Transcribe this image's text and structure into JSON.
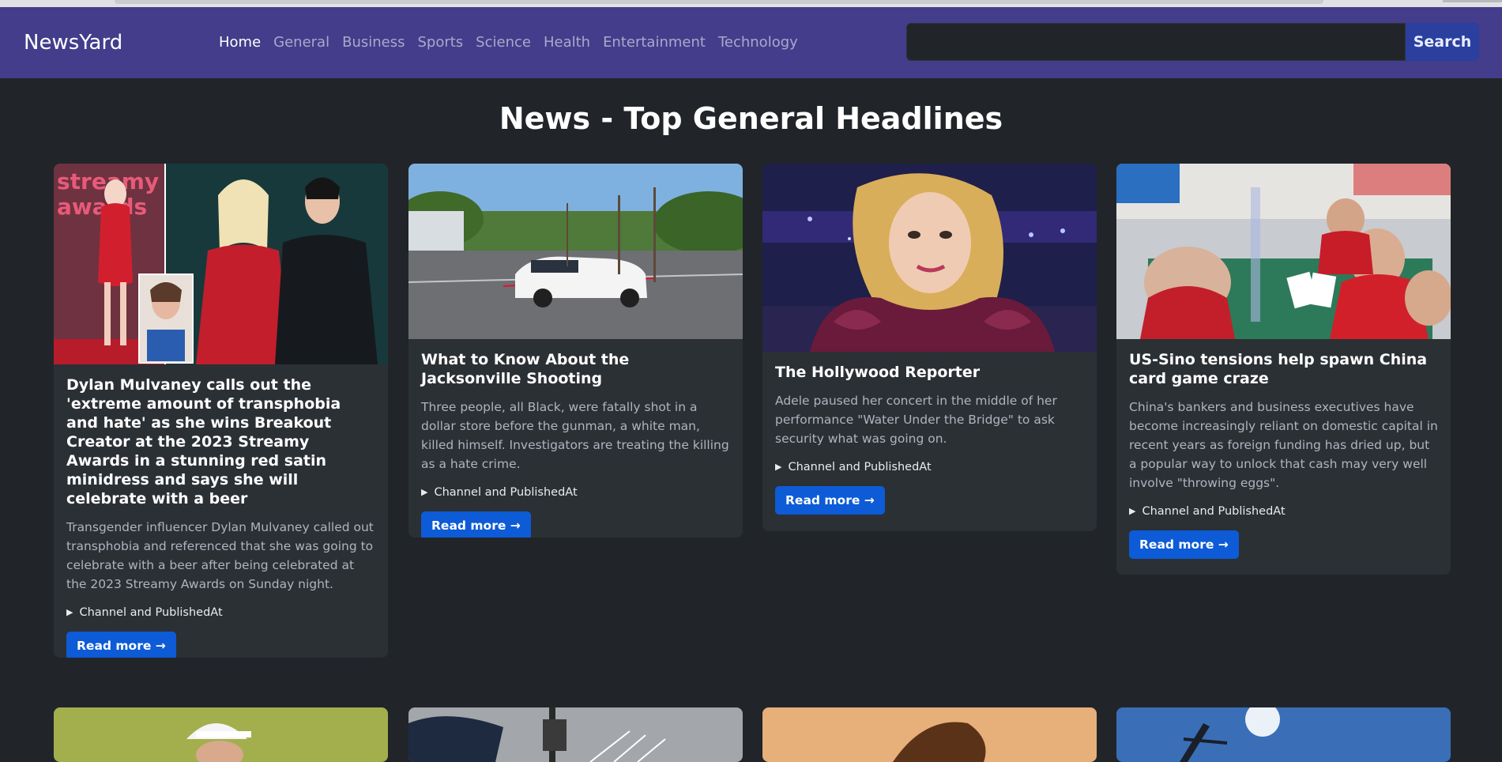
{
  "nav": {
    "brand": "NewsYard",
    "links": [
      "Home",
      "General",
      "Business",
      "Sports",
      "Science",
      "Health",
      "Entertainment",
      "Technology"
    ],
    "search_placeholder": "",
    "search_button": "Search"
  },
  "page_title": "News - Top General Headlines",
  "cards": [
    {
      "title": "Dylan Mulvaney calls out the 'extreme amount of transphobia and hate' as she wins Breakout Creator at the 2023 Streamy Awards in a stunning red satin minidress and says she will celebrate with a beer",
      "description": "Transgender influencer Dylan Mulvaney called out transphobia and referenced that she was going to celebrate with a beer after being celebrated at the 2023 Streamy Awards on Sunday night.",
      "details_label": "Channel and PublishedAt",
      "read_more": "Read more →",
      "image_text": "streamy awards"
    },
    {
      "title": "What to Know About the Jacksonville Shooting",
      "description": "Three people, all Black, were fatally shot in a dollar store before the gunman, a white man, killed himself. Investigators are treating the killing as a hate crime.",
      "details_label": "Channel and PublishedAt",
      "read_more": "Read more →"
    },
    {
      "title": "The Hollywood Reporter",
      "description": "Adele paused her concert in the middle of her performance \"Water Under the Bridge\" to ask security what was going on.",
      "details_label": "Channel and PublishedAt",
      "read_more": "Read more →"
    },
    {
      "title": "US-Sino tensions help spawn China card game craze",
      "description": "China's bankers and business executives have become increasingly reliant on domestic capital in recent years as foreign funding has dried up, but a popular way to unlock that cash may very well involve \"throwing eggs\".",
      "details_label": "Channel and PublishedAt",
      "read_more": "Read more →"
    }
  ]
}
